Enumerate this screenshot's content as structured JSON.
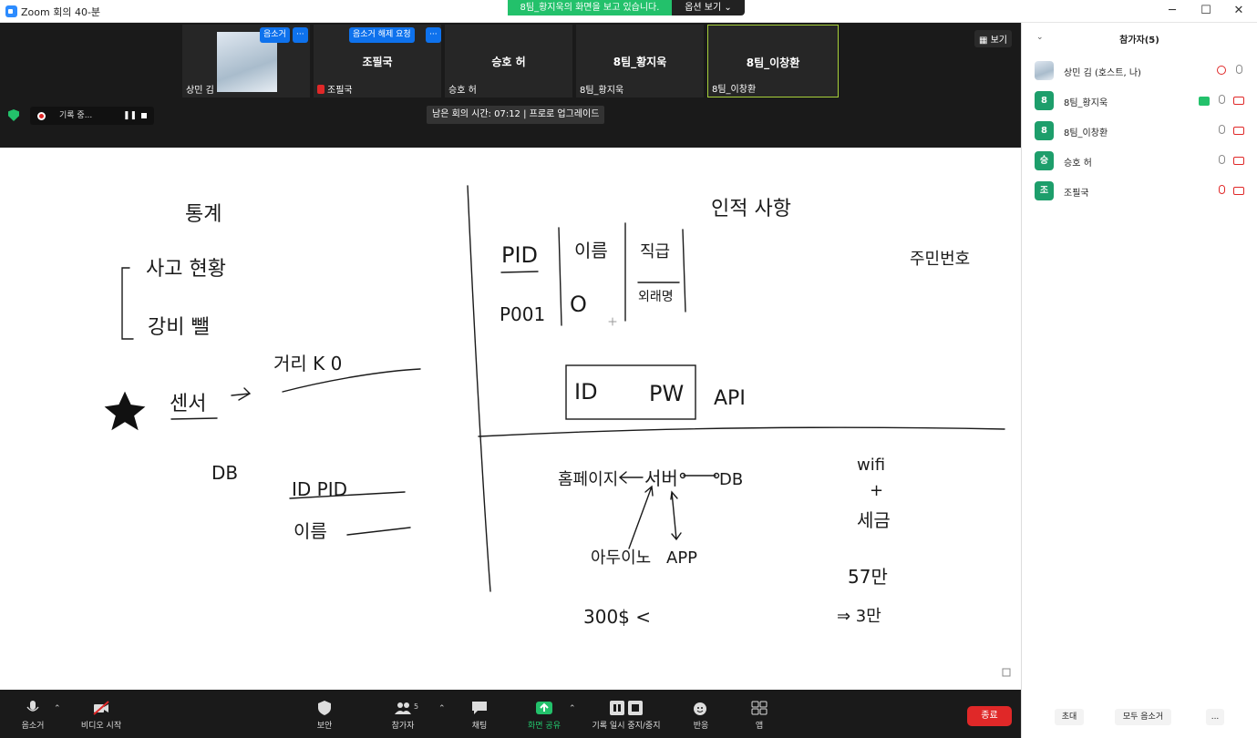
{
  "window": {
    "title": "Zoom 회의 40-분",
    "share_banner": "8팀_황지욱의 화면을 보고 있습니다.",
    "view_options": "옵션 보기 ⌄"
  },
  "video": {
    "tiles": [
      {
        "name": "상민 김",
        "center": ""
      },
      {
        "name": "조필국",
        "center": "조필국"
      },
      {
        "name": "승호 허",
        "center": "승호 허"
      },
      {
        "name": "8팀_황지욱",
        "center": "8팀_황지욱"
      },
      {
        "name": "8팀_이창환",
        "center": "8팀_이창환"
      }
    ],
    "mute_chip": "음소거",
    "unmute_request_chip": "음소거 해제 요청",
    "more_chip": "···",
    "view_button": "보기",
    "recording_label": "기록 중...",
    "remaining_time": "남은 회의 시간: 07:12 | 프로로 업그레이드"
  },
  "board": {
    "texts": [
      "통계",
      "사고 현황",
      "강비 뺄",
      "센서",
      "거리 K 0",
      "DB",
      "ID PID",
      "이름",
      "인적 사항",
      "PID",
      "이름",
      "직급",
      "P001",
      "O",
      "외래명",
      "주민번호",
      "ID",
      "PW",
      "API",
      "홈페이지",
      "서버",
      "DB",
      "아두이노",
      "APP",
      "300$ <",
      "wifi",
      "+",
      "세금",
      "57만",
      "⇒ 3만"
    ]
  },
  "toolbar": {
    "items": [
      "음소거",
      "비디오 시작",
      "보안",
      "참가자",
      "채팅",
      "화면 공유",
      "기록 일시 중지/중지",
      "반응",
      "앱"
    ],
    "participants_count": "5",
    "end": "종료"
  },
  "panel": {
    "title": "참가자(5)",
    "participants": [
      {
        "name": "상민 김 (호스트, 나)",
        "initial": ""
      },
      {
        "name": "8팀_황지욱",
        "initial": "8"
      },
      {
        "name": "8팀_이창환",
        "initial": "8"
      },
      {
        "name": "승호 허",
        "initial": "승"
      },
      {
        "name": "조필국",
        "initial": "조"
      }
    ],
    "invite": "초대",
    "mute_all": "모두 음소거",
    "more": "..."
  },
  "colors": {
    "accent_green": "#23c16b",
    "zoom_blue": "#0e72ed",
    "danger_red": "#e02828"
  }
}
